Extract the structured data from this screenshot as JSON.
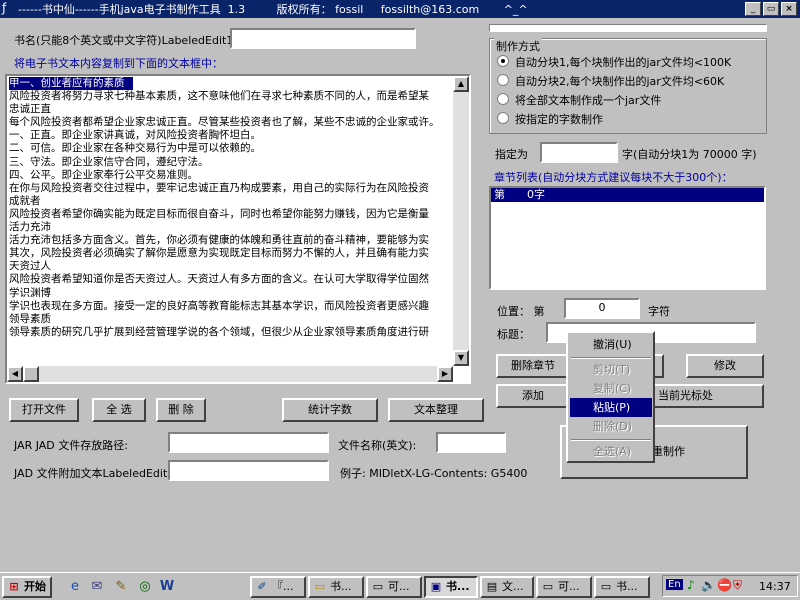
{
  "title_bar": {
    "icon": "app-icon",
    "text": "------书中仙------手机java电子书制作工具  1.3         版权所有： fossil     fossilth@163.com       ^_^",
    "buttons": [
      "_",
      "▭",
      "×"
    ]
  },
  "book_name": {
    "label": "书名(只能8个英文或中文字符)LabeledEdit1",
    "value": ""
  },
  "hint": "将电子书文本内容复制到下面的文本框中：",
  "memo": {
    "lines": [
      "甲一、创业者应有的素质",
      "  风险投资者将努力寻求七种基本素质，这不意味他们在寻求七种素质不同的人，而是希望某",
      "忠诚正直",
      "  每个风险投资者都希望企业家忠诚正直。尽管某些投资者也了解，某些不忠诚的企业家或许。",
      "一、正直。即企业家讲真诚，对风险投资者胸怀坦白。",
      "二、可信。即企业家在各种交易行为中是可以依赖的。",
      "三、守法。即企业家信守合同，遵纪守法。",
      "四、公平。即企业家奉行公平交易准则。",
      "  在你与风险投资者交往过程中，要牢记忠诚正直乃构成要素，用自己的实际行为在风险投资",
      "成就者",
      "  风险投资者希望你确实能为既定目标而很自奋斗，同时也希望你能努力赚钱，因为它是衡量",
      "活力充沛",
      "  活力充沛包括多方面含义。首先，你必须有健康的体魄和勇往直前的奋斗精神，要能够为实",
      "  其次，风险投资者必须确实了解你是愿意为实现既定目标而努力不懈的人，并且确有能力实",
      "天资过人",
      "  风险投资者希望知道你是否天资过人。天资过人有多方面的含义。在认可大学取得学位固然",
      "学识渊博",
      "  学识也表现在多方面。接受一定的良好高等教育能标志其基本学识，而风险投资者更感兴趣",
      "领导素质",
      "  领导素质的研究几乎扩展到经营管理学说的各个领域，但很少从企业家领导素质角度进行研"
    ]
  },
  "left_buttons": {
    "open": "打开文件",
    "select_all": "全 选",
    "delete": "删 除",
    "count": "统计字数",
    "arrange": "文本整理"
  },
  "jar": {
    "label": "JAR JAD 文件存放路径:",
    "path": "",
    "file_label": "文件名称(英文):",
    "file_name": "",
    "jad_label": "JAD 文件附加文本LabeledEdit2",
    "jad_value": "",
    "example": "例子: MIDletX-LG-Contents: G5400"
  },
  "mode_group": {
    "title": "制作方式",
    "options": [
      "自动分块1,每个块制作出的jar文件均<100K",
      "自动分块2,每个块制作出的jar文件均<60K",
      "将全部文本制作成一个jar文件",
      "按指定的字数制作"
    ],
    "selected": 0
  },
  "specify": {
    "label": "指定为",
    "value": "",
    "suffix": "字(自动分块1为 70000 字)"
  },
  "chapter_list": {
    "label": "章节列表(自动分块方式建议每块不大于300个)：",
    "items": [
      {
        "name": "第",
        "count": "0字"
      }
    ]
  },
  "position": {
    "label": "位置：  第",
    "value": "0",
    "unit": "字符"
  },
  "title_field": {
    "label": "标题：",
    "value": ""
  },
  "right_buttons": {
    "delete_chapter": "删除章节",
    "modify": "修改",
    "add": "添加",
    "current_cursor": "当前光标处",
    "make": "重制作"
  },
  "context_menu": {
    "items": [
      {
        "label": "撤消(U)",
        "enabled": true,
        "highlighted": false
      },
      {
        "label": "剪切(T)",
        "enabled": false,
        "highlighted": false
      },
      {
        "label": "复制(C)",
        "enabled": false,
        "highlighted": false
      },
      {
        "label": "粘贴(P)",
        "enabled": true,
        "highlighted": true
      },
      {
        "label": "删除(D)",
        "enabled": false,
        "highlighted": false
      },
      {
        "label": "全选(A)",
        "enabled": false,
        "highlighted": false
      }
    ]
  },
  "taskbar": {
    "start": "开始",
    "quick_launch": [
      "ie-icon",
      "outlook-icon",
      "notepad-icon",
      "app-icon",
      "word-icon"
    ],
    "tasks": [
      {
        "label": "『...",
        "icon": "pen-icon"
      },
      {
        "label": "书...",
        "icon": "folder-icon"
      },
      {
        "label": "可...",
        "icon": "window-icon"
      },
      {
        "label": "书...",
        "icon": "java-icon",
        "pressed": true
      },
      {
        "label": "文...",
        "icon": "doc-icon"
      },
      {
        "label": "可...",
        "icon": "window-icon"
      },
      {
        "label": "书...",
        "icon": "window-icon"
      }
    ],
    "tray": {
      "lang": "En",
      "time": "14:37"
    }
  }
}
